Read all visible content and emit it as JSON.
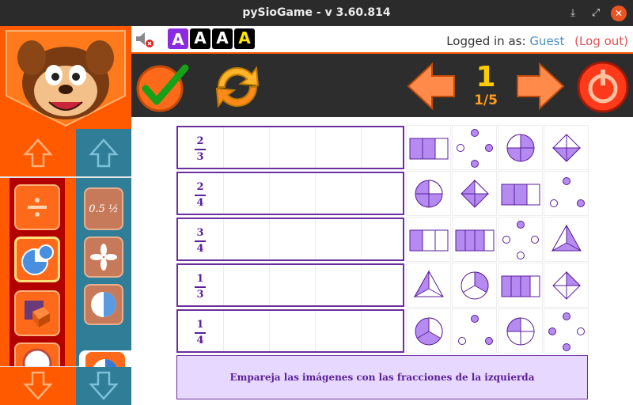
{
  "window": {
    "title": "pySioGame - v 3.60.814",
    "buttons": [
      "download",
      "fullscreen",
      "close"
    ]
  },
  "header": {
    "logged_in_label": "Logged in as:",
    "user": "Guest",
    "logout": "(Log out)",
    "font_buttons": [
      "A",
      "A",
      "A",
      "A"
    ]
  },
  "toolbar": {
    "level": "1",
    "progress": "1/5"
  },
  "game": {
    "fractions": [
      {
        "num": "2",
        "den": "3"
      },
      {
        "num": "2",
        "den": "4"
      },
      {
        "num": "3",
        "den": "4"
      },
      {
        "num": "1",
        "den": "3"
      },
      {
        "num": "1",
        "den": "4"
      }
    ],
    "instruction": "Empareja las imágenes con las fracciones de la izquierda"
  },
  "sidebar": {
    "categories": [
      "division",
      "fractions-pie",
      "geometry-cube",
      "clock"
    ],
    "games": [
      "fraction-decimal",
      "star-shapes",
      "half-circle",
      "circle-quarters"
    ]
  },
  "colors": {
    "accent": "#ff5a00",
    "teal": "#2f7d97",
    "purple": "#5a1f99",
    "tile_fill": "#b58bf2",
    "toolbar_bg": "#2d2d2d"
  }
}
